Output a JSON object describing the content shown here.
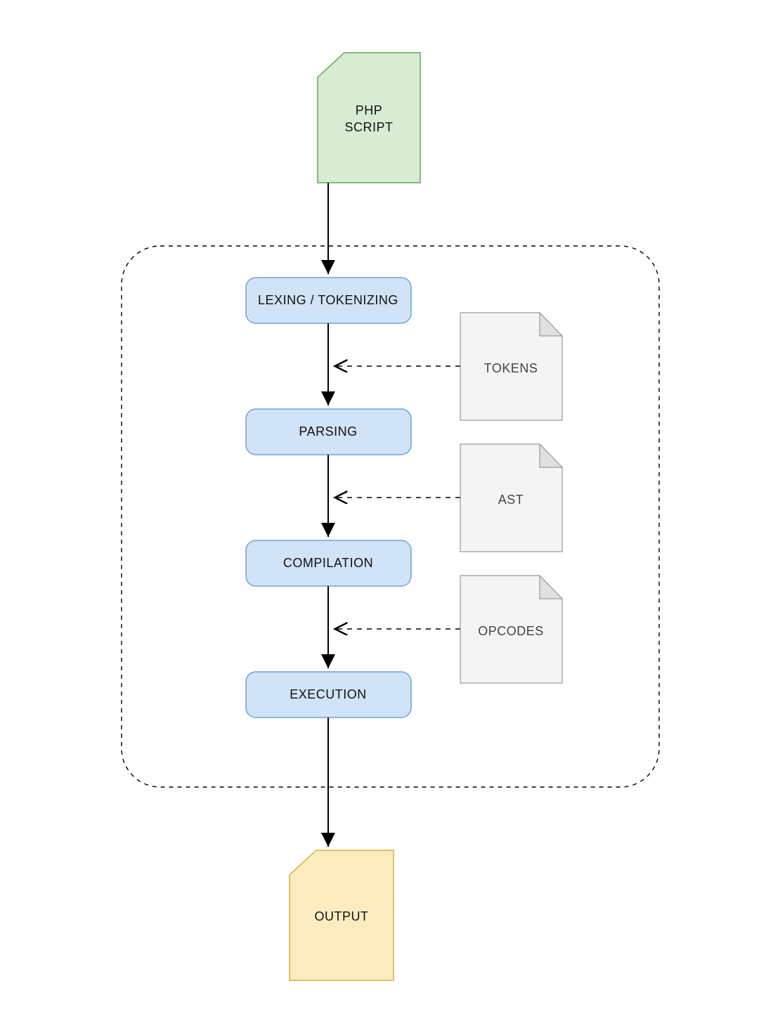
{
  "input": {
    "line1": "PHP",
    "line2": "SCRIPT"
  },
  "stages": [
    {
      "label": "LEXING / TOKENIZING"
    },
    {
      "label": "PARSING"
    },
    {
      "label": "COMPILATION"
    },
    {
      "label": "EXECUTION"
    }
  ],
  "artifacts": [
    {
      "label": "TOKENS"
    },
    {
      "label": "AST"
    },
    {
      "label": "OPCODES"
    }
  ],
  "output": {
    "label": "OUTPUT"
  },
  "colors": {
    "process_fill": "#d0e3f7",
    "process_stroke": "#6fa3d8",
    "doc_fill": "#f4f4f4",
    "doc_stroke": "#9a9a9a",
    "input_fill": "#d7ecd2",
    "input_stroke": "#6aa357",
    "output_fill": "#fcecc0",
    "output_stroke": "#d8b13a"
  }
}
